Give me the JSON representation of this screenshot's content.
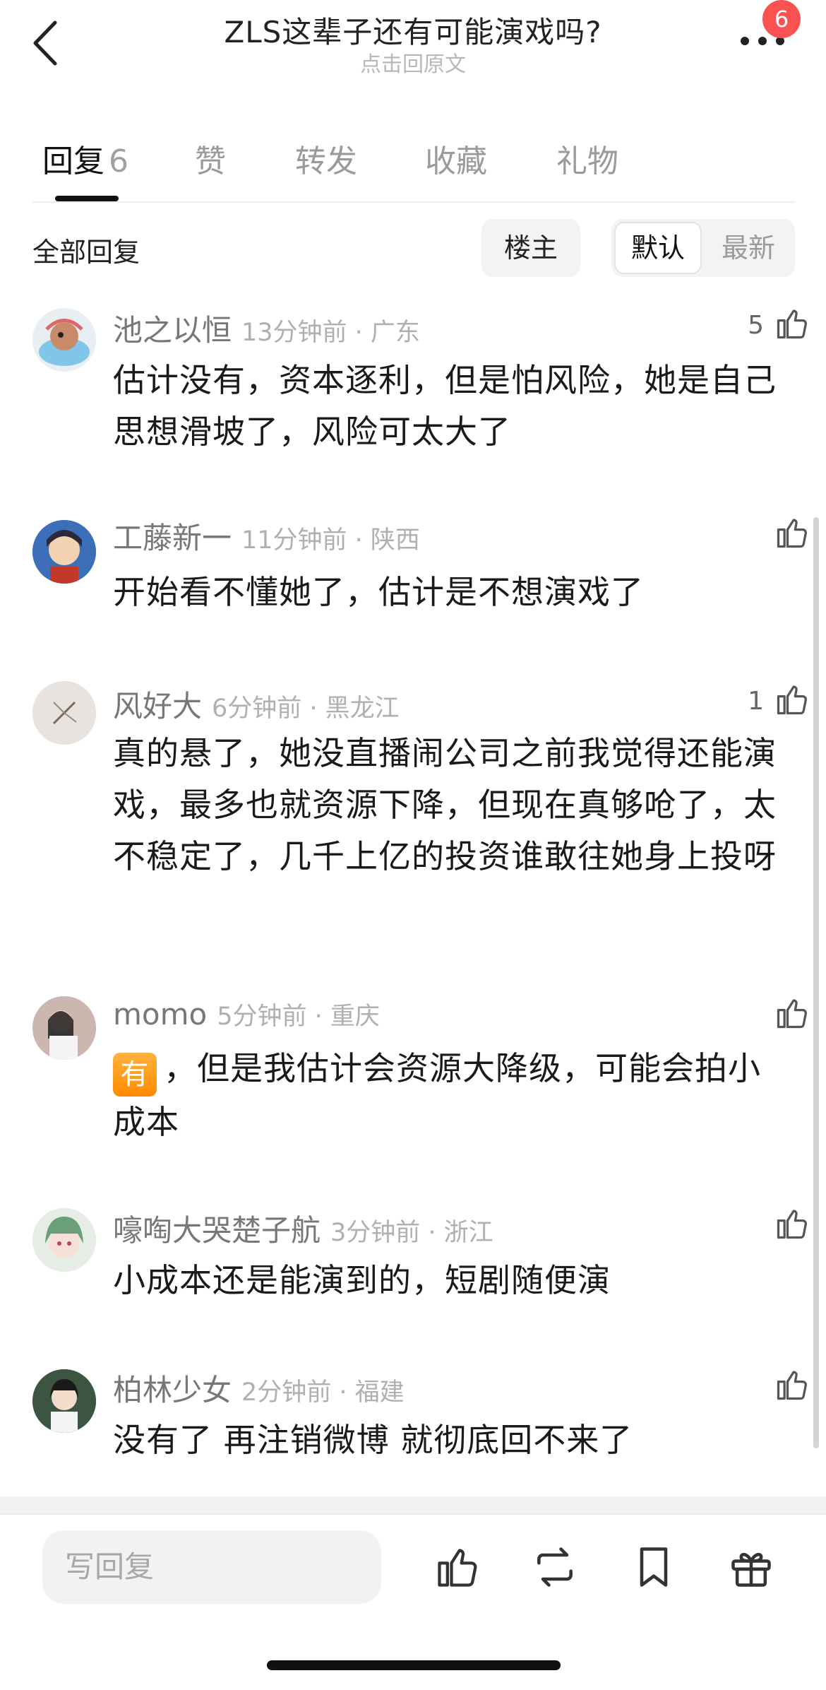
{
  "header": {
    "title": "ZLS这辈子还有可能演戏吗?",
    "subtitle": "点击回原文",
    "notification_count": "6"
  },
  "tabs": [
    {
      "label": "回复",
      "count": "6"
    },
    {
      "label": "赞"
    },
    {
      "label": "转发"
    },
    {
      "label": "收藏"
    },
    {
      "label": "礼物"
    }
  ],
  "filter": {
    "all_replies": "全部回复",
    "owner": "楼主",
    "sort_default": "默认",
    "sort_newest": "最新"
  },
  "comments": [
    {
      "user": "池之以恒",
      "time": "13分钟前 · 广东",
      "likes": "5",
      "text": "估计没有，资本逐利，但是怕风险，她是自己思想滑坡了，风险可太大了"
    },
    {
      "user": "工藤新一",
      "time": "11分钟前 · 陕西",
      "likes": "",
      "text": "开始看不懂她了，估计是不想演戏了"
    },
    {
      "user": "风好大",
      "time": "6分钟前 · 黑龙江",
      "likes": "1",
      "text": "真的悬了，她没直播闹公司之前我觉得还能演戏，最多也就资源下降，但现在真够呛了，太不稳定了，几千上亿的投资谁敢往她身上投呀"
    },
    {
      "user": "momo",
      "time": "5分钟前 · 重庆",
      "likes": "",
      "emoji": "有",
      "text": "，但是我估计会资源大降级，可能会拍小成本"
    },
    {
      "user": "嚎啕大哭楚子航",
      "time": "3分钟前 · 浙江",
      "likes": "",
      "text": "小成本还是能演到的，短剧随便演"
    },
    {
      "user": "柏林少女",
      "time": "2分钟前 · 福建",
      "likes": "",
      "text": "没有了 再注销微博 就彻底回不来了"
    }
  ],
  "bottom_bar": {
    "reply_placeholder": "写回复",
    "icons": [
      "like-icon",
      "repost-icon",
      "bookmark-icon",
      "gift-icon"
    ]
  },
  "colors": {
    "badge": "#fa5151",
    "emoji_badge": "#ff9a1f"
  }
}
